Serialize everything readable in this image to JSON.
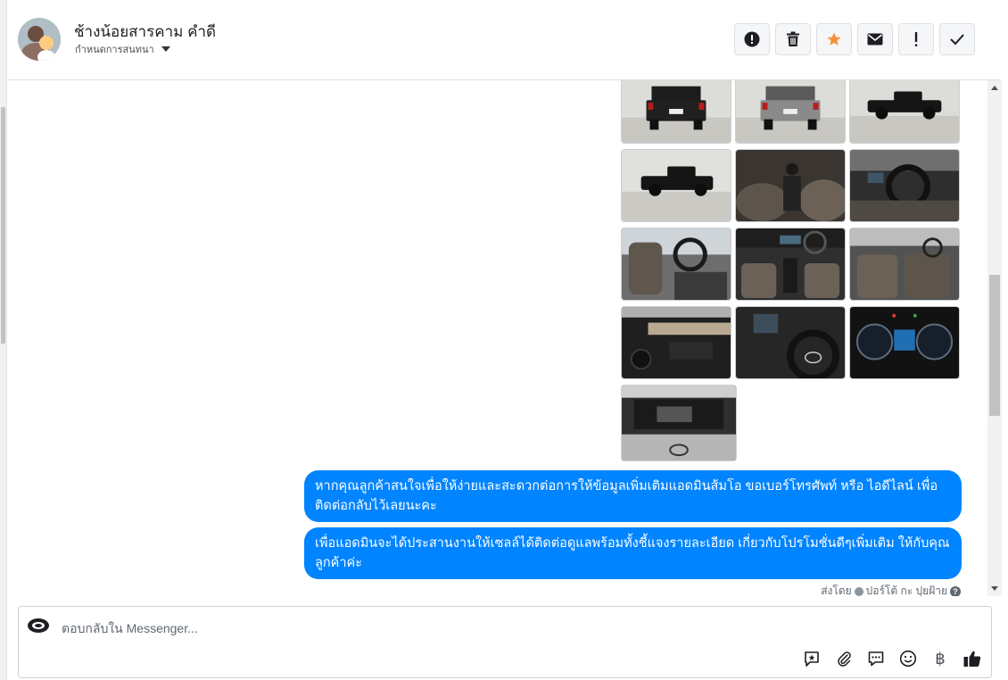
{
  "header": {
    "contact_name": "ช้างน้อยสารคาม คำดี",
    "assign_label": "กำหนดการสนทนา",
    "actions": [
      {
        "name": "mark-spam-button",
        "icon": "alert-circle-icon"
      },
      {
        "name": "delete-button",
        "icon": "trash-icon"
      },
      {
        "name": "star-button",
        "icon": "star-icon",
        "color": "#f7923b"
      },
      {
        "name": "mark-unread-button",
        "icon": "envelope-icon"
      },
      {
        "name": "follow-up-button",
        "icon": "exclamation-icon"
      },
      {
        "name": "mark-done-button",
        "icon": "checkmark-icon"
      }
    ]
  },
  "gallery": {
    "photos": [
      "pickup-rear-black",
      "pickup-rear-silver",
      "pickup-side-black",
      "pickup-side-black-2",
      "gear-shift-interior",
      "dashboard-steering",
      "front-seats",
      "interior-top-view",
      "rear-cabin",
      "door-panel",
      "steering-wheel-closeup",
      "instrument-cluster",
      "engine-bay"
    ]
  },
  "messages": [
    {
      "text": "หากคุณลูกค้าสนใจเพื่อให้ง่ายและสะดวกต่อการให้ข้อมูลเพิ่มเติมแอดมินส้มโอ ขอเบอร์โทรศัพท์ หรือ ไอดีไลน์ เพื่อติดต่อกลับไว้เลยนะคะ"
    },
    {
      "text": "เพื่อแอดมินจะได้ประสานงานให้เซลล์ได้ติดต่อดูแลพร้อมทั้งชี้แจงรายละเอียด เกี่ยวกับโปรโมชั่นดีๆเพิ่มเติม ให้กับคุณลูกค้าค่ะ"
    }
  ],
  "sent_by": {
    "prefix": "ส่งโดย",
    "name": "ปอร์โต้ กะ ปุยฝ้าย"
  },
  "composer": {
    "placeholder": "ตอบกลับใน Messenger...",
    "baht_symbol": "฿"
  },
  "colors": {
    "bubble": "#0084ff",
    "star": "#f7923b",
    "like": "#1c1e21"
  }
}
